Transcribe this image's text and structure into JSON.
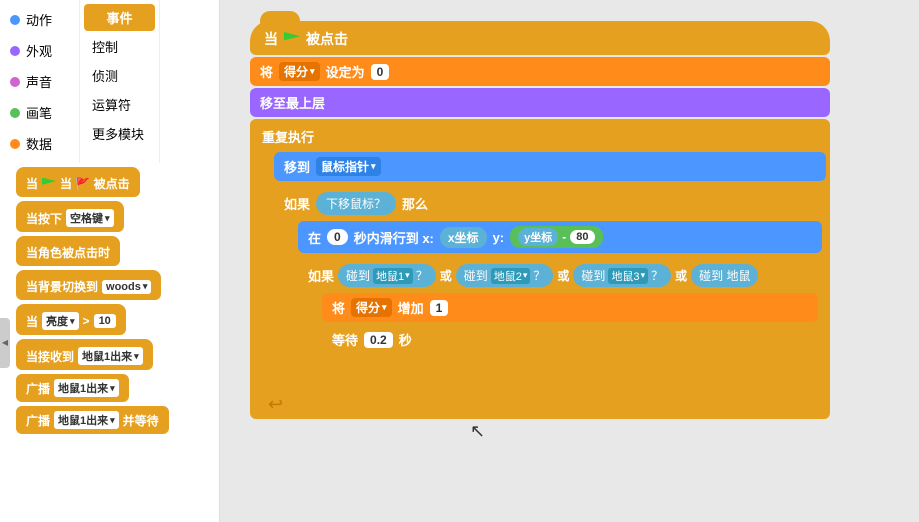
{
  "sidebar": {
    "categories": [
      {
        "label": "动作",
        "color": "#4c97ff",
        "active": false
      },
      {
        "label": "外观",
        "color": "#9966ff",
        "active": false
      },
      {
        "label": "声音",
        "color": "#cf63cf",
        "active": false
      },
      {
        "label": "画笔",
        "color": "#59c059",
        "active": false
      },
      {
        "label": "数据",
        "color": "#ff8c1a",
        "active": false
      }
    ],
    "active_category": "事件",
    "subcategories": [
      {
        "label": "控制",
        "active": false
      },
      {
        "label": "侦测",
        "active": false
      },
      {
        "label": "运算符",
        "active": false
      },
      {
        "label": "更多模块",
        "active": false
      }
    ],
    "active_tab": "事件"
  },
  "left_blocks": [
    {
      "type": "event",
      "text": "当 🚩 被点击",
      "color": "#e6a020"
    },
    {
      "type": "event",
      "text": "当按下 空格键 ▾",
      "color": "#e6a020"
    },
    {
      "type": "event",
      "text": "当角色被点击时",
      "color": "#e6a020"
    },
    {
      "type": "event",
      "text": "当背景切换到 woods ▾",
      "color": "#e6a020"
    },
    {
      "type": "event",
      "text": "当 亮度 ▾ > 10",
      "color": "#e6a020"
    },
    {
      "type": "event",
      "text": "当接收到 地鼠1出来 ▾",
      "color": "#e6a020"
    },
    {
      "type": "event",
      "text": "广播 地鼠1出来 ▾",
      "color": "#e6a020"
    },
    {
      "type": "event",
      "text": "广播 地鼠1出来 ▾ 并等待",
      "color": "#e6a020"
    }
  ],
  "canvas": {
    "blocks": {
      "trigger": "当 🚩 被点击",
      "set_score": "将 得分 ▾ 设定为 0",
      "go_front": "移至最上层",
      "repeat": "重复执行",
      "move_mouse": "移到 鼠标指针",
      "if_label": "如果",
      "down_mouse": "下移鼠标？",
      "then_label": "那么",
      "glide": "在 0 秒内滑行到 x:",
      "x_coord": "x坐标",
      "y_label": "y:",
      "y_coord": "y坐标",
      "minus": "-",
      "value_80": "80",
      "if2_label": "如果",
      "touch1": "碰到 地鼠1",
      "q1": "？",
      "or1": "或",
      "touch2": "碰到 地鼠2",
      "q2": "？",
      "or2": "或",
      "touch3": "碰到 地鼠3",
      "q3": "？",
      "or3": "或",
      "touch4": "碰到 地鼠",
      "add_score": "将 得分 ▾ 增加 1",
      "wait": "等待 0.2 秒"
    }
  }
}
